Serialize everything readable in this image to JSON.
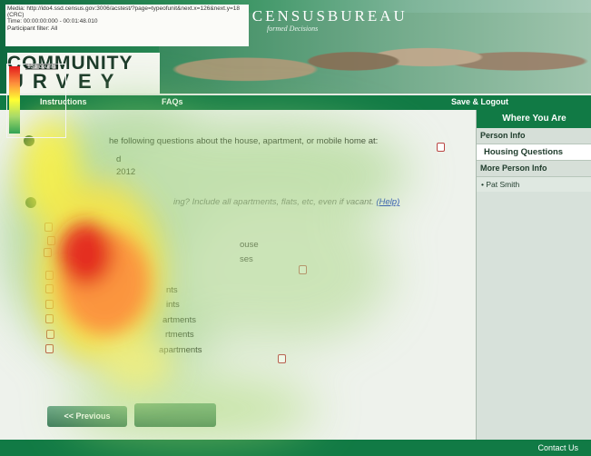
{
  "meta": {
    "media": "Media: http://ido4.ssd.census.gov:3006/acstest/?page=typeofunit&next.x=126&next.y=18 (CRC)",
    "time": "Time: 00:00:00:000 - 00:01:48.010",
    "filter": "Participant filter: All",
    "counts": "136 counts"
  },
  "header": {
    "bureau": "USCENSUSBUREAU",
    "tagline": "formed Decisions",
    "logo_top": "COMMUNITY",
    "logo_bottom": "URVEY"
  },
  "nav": {
    "instructions": "Instructions",
    "faqs": "FAQs",
    "save_logout": "Save & Logout"
  },
  "main": {
    "intro": "he following questions about the house, apartment, or mobile home at:",
    "address_line1": "d",
    "address_line2": "2012",
    "question": "ing? Include all apartments, flats, etc, even if vacant.",
    "help": "(Help)",
    "options": [
      "ouse",
      "ses",
      "nts",
      "ints",
      "artments",
      "rtments",
      "apartments"
    ]
  },
  "buttons": {
    "previous": "<< Previous"
  },
  "sidebar": {
    "title": "Where You Are",
    "person_info": "Person Info",
    "housing": "Housing Questions",
    "more_person": "More Person Info",
    "person": "• Pat Smith"
  },
  "footer": {
    "contact": "Contact Us"
  },
  "colors": {
    "brand_green": "#117a45",
    "heat_hot": "#e31a1c",
    "heat_warm": "#ffff33",
    "heat_cool": "#a6d96a"
  }
}
